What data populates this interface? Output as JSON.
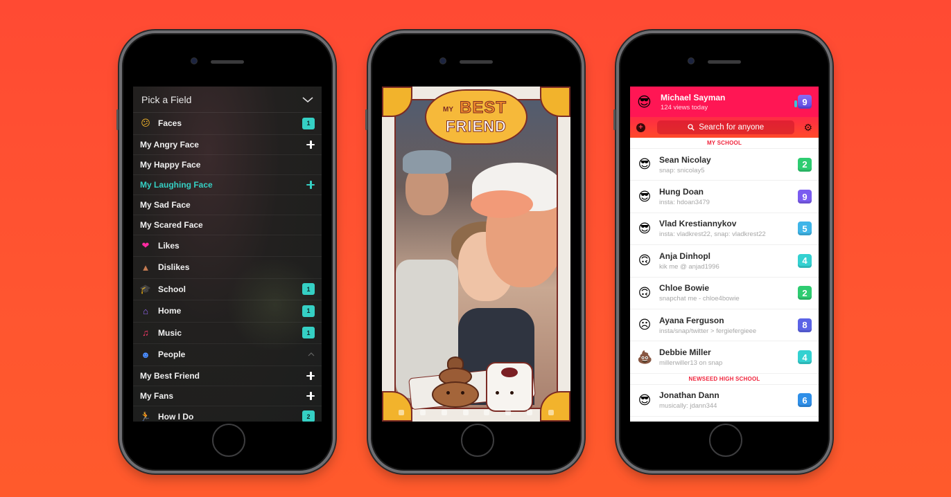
{
  "colors": {
    "background": "#ff4e33",
    "teal_accent": "#35d0c4",
    "header_pink": "#ff1654",
    "section_red": "#f0243c"
  },
  "left_phone": {
    "header": {
      "title": "Pick a Field",
      "icon": "chevron-down-icon"
    },
    "rows": [
      {
        "type": "category",
        "icon": "😕",
        "icon_name": "face-emoji-icon",
        "label": "Faces",
        "badge": "1"
      },
      {
        "type": "sub",
        "label": "My Angry Face",
        "action": "plus"
      },
      {
        "type": "sub",
        "label": "My Happy Face",
        "action": ""
      },
      {
        "type": "sub",
        "label": "My Laughing Face",
        "action": "plus",
        "active": true
      },
      {
        "type": "sub",
        "label": "My Sad Face",
        "action": ""
      },
      {
        "type": "sub",
        "label": "My Scared Face",
        "action": ""
      },
      {
        "type": "category",
        "icon": "❤",
        "icon_name": "heart-icon",
        "label": "Likes",
        "badge": ""
      },
      {
        "type": "category",
        "icon": "▲",
        "icon_name": "poop-icon",
        "label": "Dislikes",
        "badge": ""
      },
      {
        "type": "category",
        "icon": "🎓",
        "icon_name": "graduation-cap-icon",
        "label": "School",
        "badge": "1"
      },
      {
        "type": "category",
        "icon": "⌂",
        "icon_name": "home-icon",
        "label": "Home",
        "badge": "1"
      },
      {
        "type": "category",
        "icon": "♫",
        "icon_name": "music-note-icon",
        "label": "Music",
        "badge": "1"
      },
      {
        "type": "category",
        "icon": "☻",
        "icon_name": "people-icon",
        "label": "People",
        "badge": "",
        "expanded": true
      },
      {
        "type": "sub",
        "label": "My Best Friend",
        "action": "plus"
      },
      {
        "type": "sub",
        "label": "My Fans",
        "action": "plus"
      },
      {
        "type": "category",
        "icon": "🏃",
        "icon_name": "running-icon",
        "label": "How I Do",
        "badge": "2"
      }
    ]
  },
  "middle_phone": {
    "sticker": {
      "line1": "MY",
      "line2": "BEST",
      "line3": "FRIEND"
    }
  },
  "right_phone": {
    "profile": {
      "avatar": "😎",
      "name": "Michael Sayman",
      "views": "124 views today",
      "count": "9"
    },
    "search": {
      "placeholder": "Search for anyone"
    },
    "sections": [
      {
        "title": "MY SCHOOL",
        "people": [
          {
            "emoji": "😎",
            "name": "Sean Nicolay",
            "handle": "snap: snicolay5",
            "count": "2",
            "color": "#2ecc71"
          },
          {
            "emoji": "😎",
            "name": "Hung Doan",
            "handle": "insta: hdoan3479",
            "count": "9",
            "color": "#7a5cf0"
          },
          {
            "emoji": "😎",
            "name": "Vlad Krestiannykov",
            "handle": "insta: vladkrest22, snap: vladkrest22",
            "count": "5",
            "color": "#3fb5e8"
          },
          {
            "emoji": "🙃",
            "name": "Anja Dinhopl",
            "handle": "kik me @ anjad1996",
            "count": "4",
            "color": "#34d1d1"
          },
          {
            "emoji": "🙃",
            "name": "Chloe Bowie",
            "handle": "snapchat me - chloe4bowie",
            "count": "2",
            "color": "#2ecc71"
          },
          {
            "emoji": "☹",
            "name": "Ayana Ferguson",
            "handle": "insta/snap/twitter > fergiefergieee",
            "count": "8",
            "color": "#5b63e6"
          },
          {
            "emoji": "💩",
            "name": "Debbie Miller",
            "handle": "millerwiller13 on snap",
            "count": "4",
            "color": "#34d1d1"
          }
        ]
      },
      {
        "title": "NEWSEED HIGH SCHOOL",
        "people": [
          {
            "emoji": "😎",
            "name": "Jonathan Dann",
            "handle": "musically: jdann344",
            "count": "6",
            "color": "#2f8fe8"
          }
        ]
      }
    ]
  }
}
